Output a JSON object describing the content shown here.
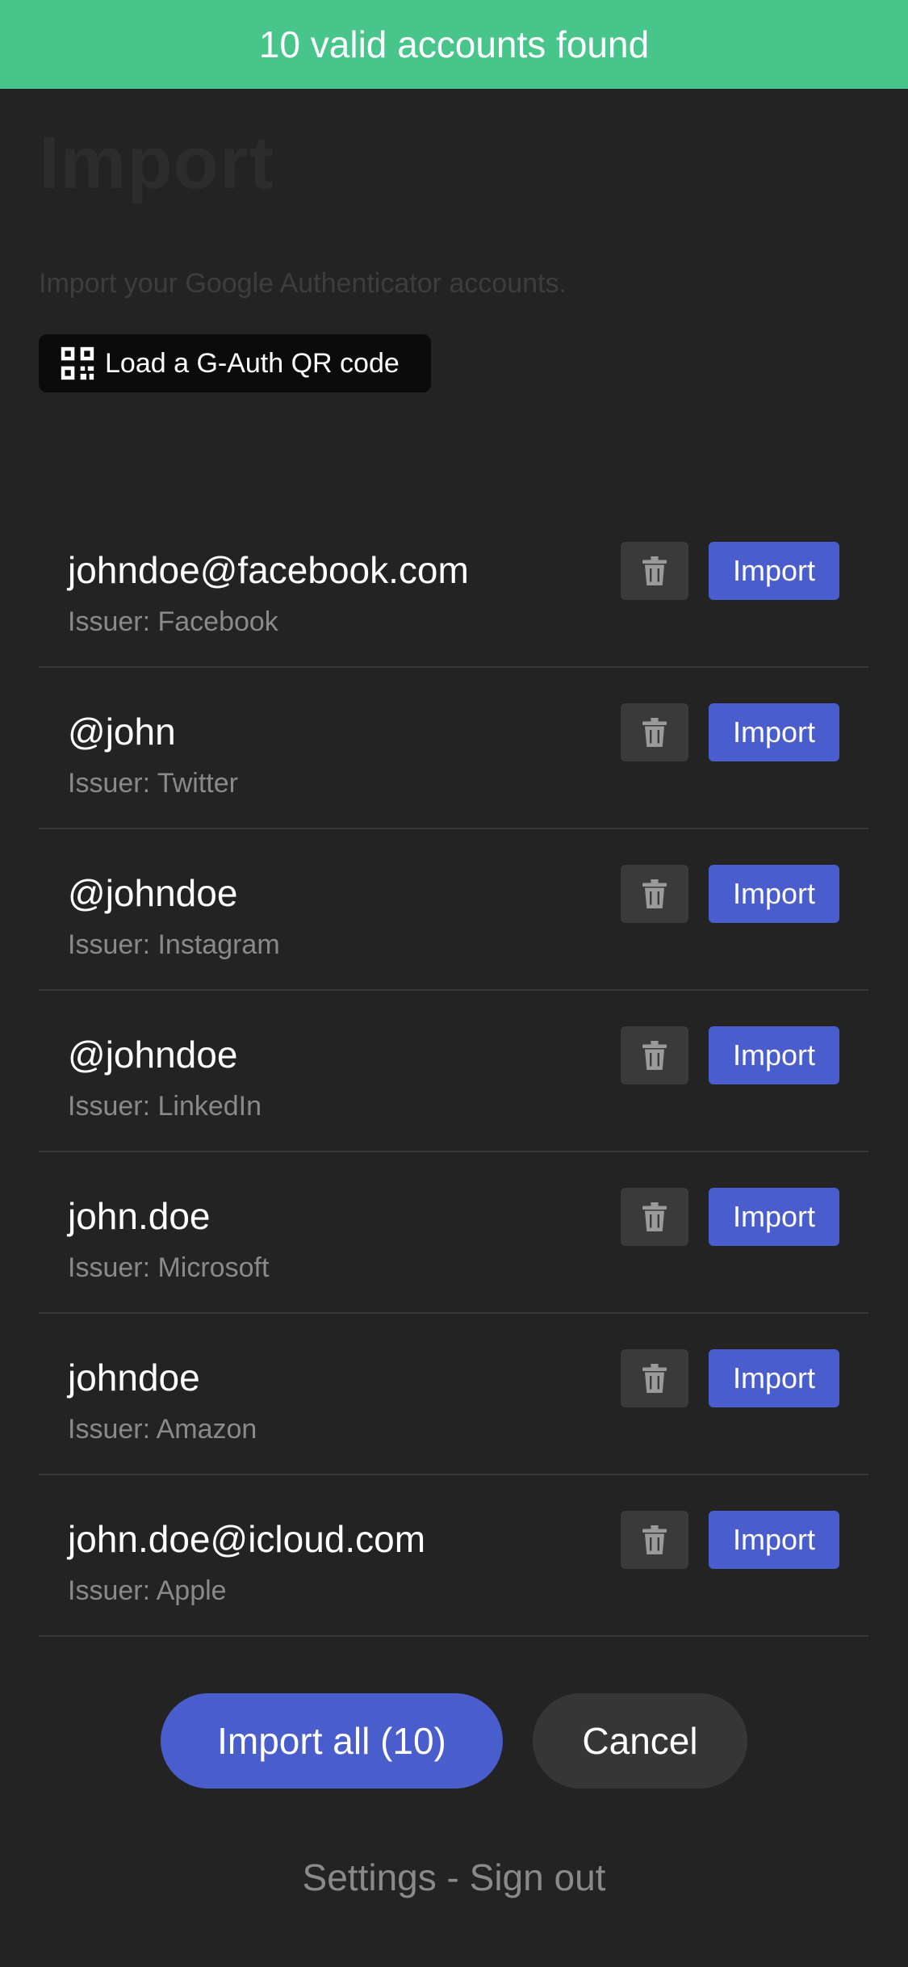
{
  "banner": {
    "text": "10 valid accounts found",
    "color": "#48c58b"
  },
  "page": {
    "title": "Import",
    "subtitle": "Import your Google Authenticator accounts.",
    "qr_button_label": "Load a G-Auth QR code",
    "qr_button_icon": "qr-code-icon"
  },
  "accounts": [
    {
      "name": "johndoe@facebook.com",
      "issuer": "Issuer: Facebook",
      "import_label": "Import",
      "delete_icon": "trash-icon"
    },
    {
      "name": "@john",
      "issuer": "Issuer: Twitter",
      "import_label": "Import",
      "delete_icon": "trash-icon"
    },
    {
      "name": "@johndoe",
      "issuer": "Issuer: Instagram",
      "import_label": "Import",
      "delete_icon": "trash-icon"
    },
    {
      "name": "@johndoe",
      "issuer": "Issuer: LinkedIn",
      "import_label": "Import",
      "delete_icon": "trash-icon"
    },
    {
      "name": "john.doe",
      "issuer": "Issuer: Microsoft",
      "import_label": "Import",
      "delete_icon": "trash-icon"
    },
    {
      "name": "johndoe",
      "issuer": "Issuer: Amazon",
      "import_label": "Import",
      "delete_icon": "trash-icon"
    },
    {
      "name": "john.doe@icloud.com",
      "issuer": "Issuer: Apple",
      "import_label": "Import",
      "delete_icon": "trash-icon"
    }
  ],
  "actions": {
    "import_all_label": "Import all (10)",
    "cancel_label": "Cancel"
  },
  "footer": {
    "settings_label": "Settings",
    "separator": " - ",
    "sign_out_label": "Sign out"
  },
  "colors": {
    "background": "#232323",
    "accent": "#4a5dcc",
    "success": "#48c58b"
  }
}
